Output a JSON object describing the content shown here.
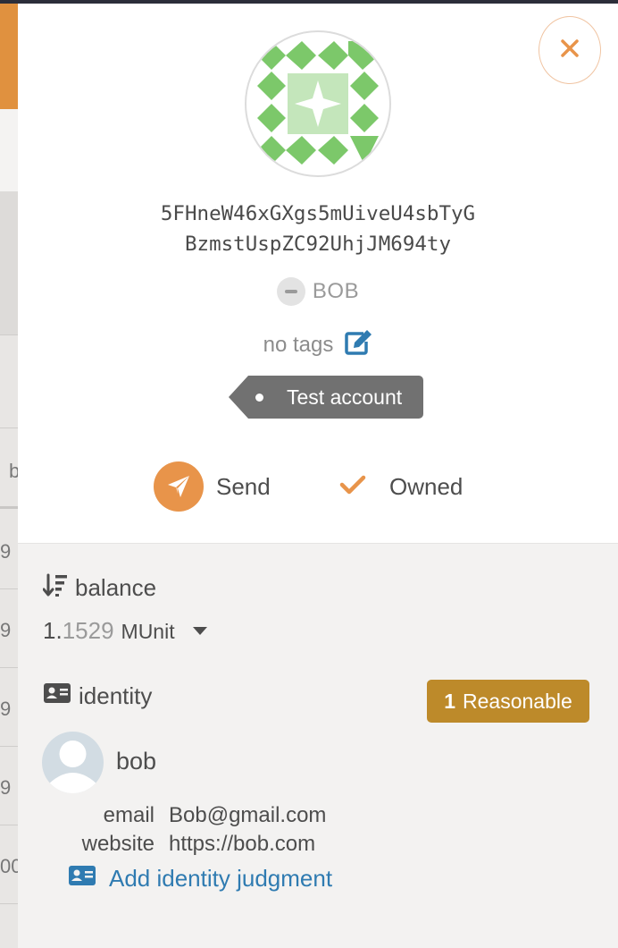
{
  "account": {
    "address_line1": "5FHneW46xGXgs5mUiveU4sbTyG",
    "address_line2": "BzmstUspZC92UhjJM694ty",
    "name": "BOB",
    "tags_text": "no tags",
    "tag_label": "Test account"
  },
  "actions": {
    "send_label": "Send",
    "owned_label": "Owned"
  },
  "balance": {
    "title": "balance",
    "value_int": "1.",
    "value_dec": "1529",
    "unit": "MUnit"
  },
  "identity": {
    "title": "identity",
    "judgement_count": "1",
    "judgement_label": "Reasonable",
    "display_name": "bob",
    "email_key": "email",
    "email_value": "Bob@gmail.com",
    "website_key": "website",
    "website_value": "https://bob.com",
    "add_judgment_label": "Add identity judgment"
  },
  "background": {
    "row_chars": [
      "b",
      "9",
      "9",
      "9",
      "9",
      "00"
    ]
  },
  "colors": {
    "accent": "#e8944a",
    "badge": "#bd8a2a",
    "link": "#2f7bb1",
    "identicon_green": "#7cc86a"
  },
  "icons": {
    "close": "close-icon",
    "send": "paper-plane-icon",
    "owned": "check-icon",
    "edit": "edit-icon",
    "sort": "sort-amount-icon",
    "identity": "id-card-icon"
  }
}
